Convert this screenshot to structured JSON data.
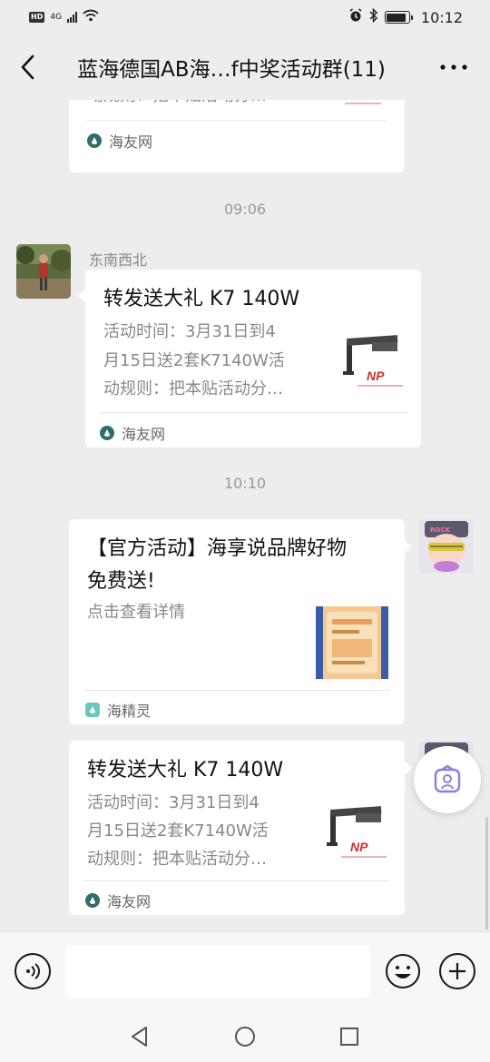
{
  "status_bar": {
    "hd": "HD",
    "network": "4G",
    "time": "10:12",
    "battery_level": 0.9
  },
  "header": {
    "title": "蓝海德国AB海…f中奖活动群(11)",
    "back_icon": "chevron-left-icon",
    "more_icon": "more-dots-icon",
    "more_label": "···"
  },
  "messages": [
    {
      "type": "link-card",
      "side": "right",
      "partial": true,
      "desc_last_line": "动规则：把本贴活动分…",
      "source": "海友网"
    },
    {
      "type": "time",
      "text": "09:06"
    },
    {
      "type": "link-card",
      "side": "left",
      "sender": "东南西北",
      "title": "转发送大礼 K7 140W",
      "desc_lines": [
        "活动时间：3月31日到4",
        "月15日送2套K7140W活",
        "动规则：把本贴活动分…"
      ],
      "source": "海友网"
    },
    {
      "type": "time",
      "text": "10:10"
    },
    {
      "type": "link-card",
      "side": "right",
      "title_lines": [
        "【官方活动】海享说品牌好物",
        "免费送!"
      ],
      "desc_lines": [
        "点击查看详情"
      ],
      "source": "海精灵"
    },
    {
      "type": "link-card",
      "side": "right",
      "title": "转发送大礼 K7 140W",
      "desc_lines": [
        "活动时间：3月31日到4",
        "月15日送2套K7140W活",
        "动规则：把本贴活动分…"
      ],
      "source": "海友网"
    }
  ],
  "input_bar": {
    "voice_icon": "voice-icon",
    "input_value": "",
    "emoji_icon": "emoji-icon",
    "plus_icon": "plus-icon"
  },
  "colors": {
    "background": "#ededed",
    "card": "#ffffff",
    "muted_text": "#888888",
    "time_text": "#999999"
  }
}
